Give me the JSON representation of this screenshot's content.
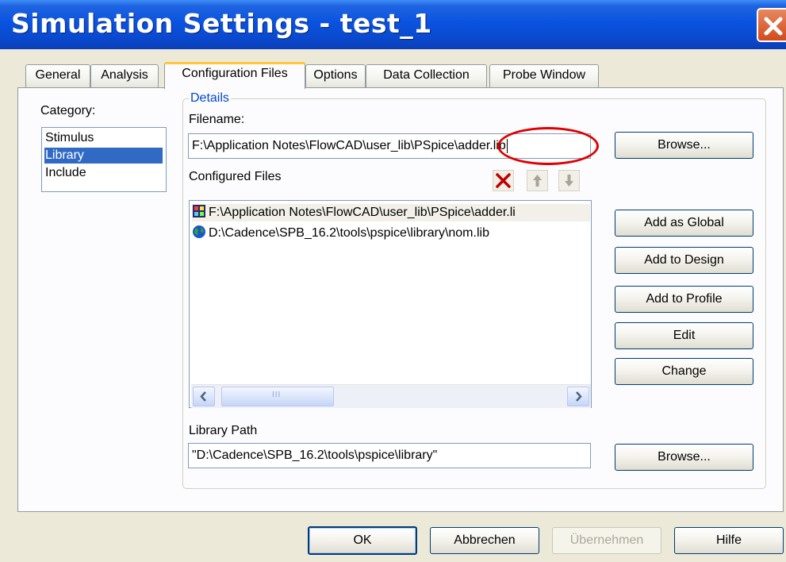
{
  "window": {
    "title": "Simulation Settings - test_1",
    "accent_color": "#0a53e0"
  },
  "tabs": [
    {
      "label": "General"
    },
    {
      "label": "Analysis"
    },
    {
      "label": "Configuration Files",
      "active": true
    },
    {
      "label": "Options"
    },
    {
      "label": "Data Collection"
    },
    {
      "label": "Probe Window"
    }
  ],
  "category": {
    "label": "Category:",
    "items": [
      "Stimulus",
      "Library",
      "Include"
    ],
    "selected": "Library"
  },
  "details": {
    "legend": "Details",
    "filename_label": "Filename:",
    "filename_value": "F:\\Application Notes\\FlowCAD\\user_lib\\PSpice\\adder.lib",
    "browse_label": "Browse...",
    "configured_files_label": "Configured Files",
    "configured_files": [
      {
        "path": "F:\\Application Notes\\FlowCAD\\user_lib\\PSpice\\adder.li",
        "icon": "design-file-icon"
      },
      {
        "path": "D:\\Cadence\\SPB_16.2\\tools\\pspice\\library\\nom.lib",
        "icon": "globe-icon"
      }
    ],
    "side_buttons": {
      "add_global": "Add as Global",
      "add_design": "Add to Design",
      "add_profile": "Add to Profile",
      "edit": "Edit",
      "change": "Change"
    },
    "library_path_label": "Library Path",
    "library_path_value": "\"D:\\Cadence\\SPB_16.2\\tools\\pspice\\library\"",
    "browse2_label": "Browse...",
    "scroll_thumb_grip": "III"
  },
  "footer": {
    "ok": "OK",
    "cancel": "Abbrechen",
    "apply": "Übernehmen",
    "help": "Hilfe"
  },
  "highlight_color": "#e00000"
}
